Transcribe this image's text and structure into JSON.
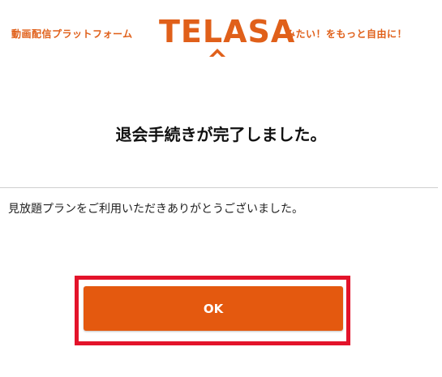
{
  "header": {
    "tagline_left": "動画配信プラットフォーム",
    "logo_text": "TELASA",
    "tagline_right": "みたい！をもっと自由に！"
  },
  "main": {
    "title": "退会手続きが完了しました。",
    "message": "見放題プランをご利用いただきありがとうございました。",
    "ok_label": "OK"
  },
  "colors": {
    "brand": "#e0601a",
    "button": "#e4590f",
    "highlight": "#e3132a"
  }
}
